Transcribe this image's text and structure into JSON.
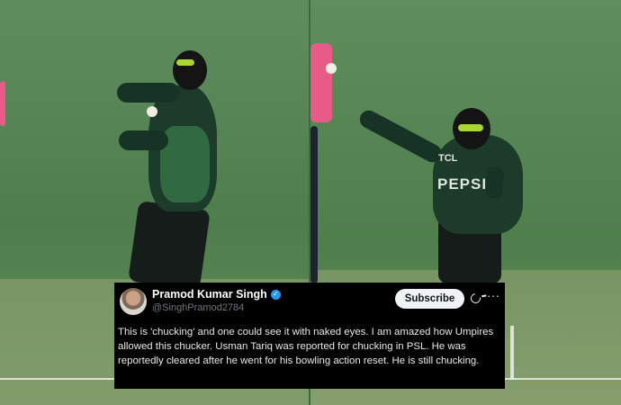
{
  "tweet": {
    "display_name": "Pramod Kumar Singh",
    "handle": "@SinghPramod2784",
    "subscribe_label": "Subscribe",
    "more_label": "···",
    "text": "This is 'chucking' and one could see it with naked eyes. I am amazed how Umpires allowed this chucker. Usman Tariq was reported for chucking in PSL. He was reportedly cleared after he went for  his bowling action reset. He is still chucking.",
    "verified": true
  },
  "right_frame": {
    "shirt_sponsor": "PEPSI",
    "shirt_brand": "TCL"
  },
  "colors": {
    "jersey": "#1d3b2a",
    "headband": "#a8d830",
    "umpire_shirt": "#e85a88",
    "verified": "#1d9bf0"
  },
  "icons": {
    "verified": "verified-badge-icon",
    "grok": "grok-icon",
    "more": "more-options-icon"
  }
}
